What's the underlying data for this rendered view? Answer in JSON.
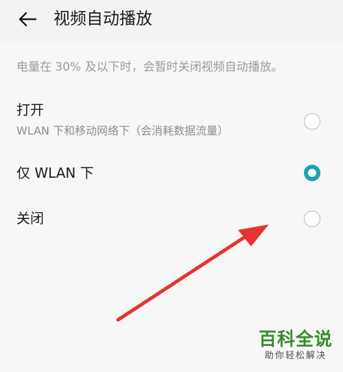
{
  "header": {
    "back_icon": "arrow-left-icon",
    "title": "视频自动播放"
  },
  "note": "电量在 30% 及以下时，会暂时关闭视频自动播放。",
  "options": [
    {
      "label": "打开",
      "sublabel": "WLAN 下和移动网络下（会消耗数据流量）",
      "selected": false
    },
    {
      "label": "仅 WLAN 下",
      "sublabel": "",
      "selected": true
    },
    {
      "label": "关闭",
      "sublabel": "",
      "selected": false
    }
  ],
  "colors": {
    "accent": "#1aa3ad",
    "arrow": "#e8322d",
    "watermark": "#3a8a2f"
  },
  "watermark": {
    "main": "百科全说",
    "sub": "助你轻松解决"
  }
}
